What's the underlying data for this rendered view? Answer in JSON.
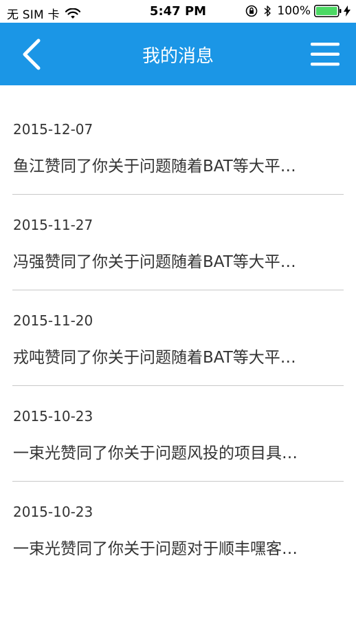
{
  "status_bar": {
    "carrier": "无 SIM 卡",
    "time": "5:47 PM",
    "battery_percent": "100%"
  },
  "nav": {
    "title": "我的消息",
    "back_icon": "chevron-left-icon",
    "menu_icon": "hamburger-menu-icon"
  },
  "colors": {
    "nav_background": "#1b96e6",
    "battery_fill": "#4cd964"
  },
  "messages": [
    {
      "date": "2015-12-07",
      "text": "鱼江赞同了你关于问题随着BAT等大平…"
    },
    {
      "date": "2015-11-27",
      "text": "冯强赞同了你关于问题随着BAT等大平…"
    },
    {
      "date": "2015-11-20",
      "text": "戎吨赞同了你关于问题随着BAT等大平…"
    },
    {
      "date": "2015-10-23",
      "text": "一束光赞同了你关于问题风投的项目具…"
    },
    {
      "date": "2015-10-23",
      "text": "一束光赞同了你关于问题对于顺丰嘿客…"
    }
  ]
}
